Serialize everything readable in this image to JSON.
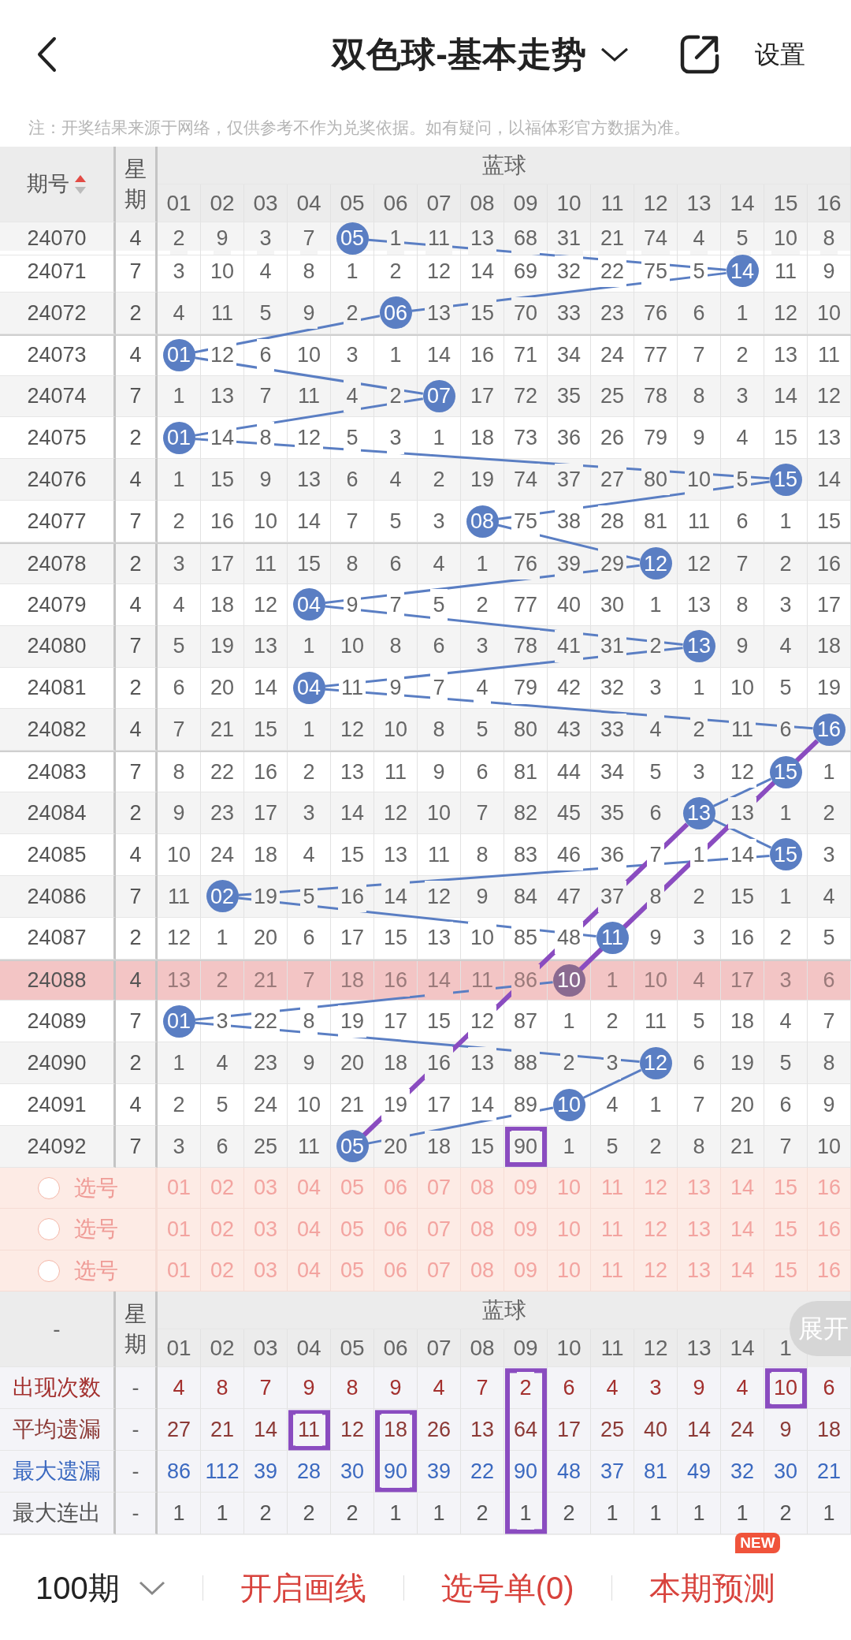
{
  "header": {
    "title": "双色球-基本走势",
    "settings": "设置"
  },
  "note": "注：开奖结果来源于网络，仅供参考不作为兑奖依据。如有疑问，以福体彩官方数据为准。",
  "table": {
    "period": "期号",
    "weekday": "星期",
    "group": "蓝球",
    "ascending": true,
    "numbers": [
      "01",
      "02",
      "03",
      "04",
      "05",
      "06",
      "07",
      "08",
      "09",
      "10",
      "11",
      "12",
      "13",
      "14",
      "15",
      "16"
    ]
  },
  "rows": [
    {
      "period": "24070",
      "weekday": "4",
      "highlighted": false,
      "cells": [
        "2",
        "9",
        "3",
        "7",
        {
          "ball": "05"
        },
        "1",
        "11",
        "13",
        "68",
        "31",
        "21",
        "74",
        "4",
        "5",
        "10",
        "8"
      ]
    },
    {
      "period": "24071",
      "weekday": "7",
      "highlighted": false,
      "cells": [
        "3",
        "10",
        "4",
        "8",
        "1",
        "2",
        "12",
        "14",
        "69",
        "32",
        "22",
        "75",
        "5",
        {
          "ball": "14"
        },
        "11",
        "9"
      ]
    },
    {
      "period": "24072",
      "weekday": "2",
      "highlighted": false,
      "cells": [
        "4",
        "11",
        "5",
        "9",
        "2",
        {
          "ball": "06"
        },
        "13",
        "15",
        "70",
        "33",
        "23",
        "76",
        "6",
        "1",
        "12",
        "10"
      ]
    },
    {
      "period": "24073",
      "weekday": "4",
      "highlighted": false,
      "cells": [
        {
          "ball": "01"
        },
        "12",
        "6",
        "10",
        "3",
        "1",
        "14",
        "16",
        "71",
        "34",
        "24",
        "77",
        "7",
        "2",
        "13",
        "11"
      ]
    },
    {
      "period": "24074",
      "weekday": "7",
      "highlighted": false,
      "cells": [
        "1",
        "13",
        "7",
        "11",
        "4",
        "2",
        {
          "ball": "07"
        },
        "17",
        "72",
        "35",
        "25",
        "78",
        "8",
        "3",
        "14",
        "12"
      ]
    },
    {
      "period": "24075",
      "weekday": "2",
      "highlighted": false,
      "cells": [
        {
          "ball": "01"
        },
        "14",
        "8",
        "12",
        "5",
        "3",
        "1",
        "18",
        "73",
        "36",
        "26",
        "79",
        "9",
        "4",
        "15",
        "13"
      ]
    },
    {
      "period": "24076",
      "weekday": "4",
      "highlighted": false,
      "cells": [
        "1",
        "15",
        "9",
        "13",
        "6",
        "4",
        "2",
        "19",
        "74",
        "37",
        "27",
        "80",
        "10",
        "5",
        {
          "ball": "15"
        },
        "14"
      ]
    },
    {
      "period": "24077",
      "weekday": "7",
      "highlighted": false,
      "cells": [
        "2",
        "16",
        "10",
        "14",
        "7",
        "5",
        "3",
        {
          "ball": "08"
        },
        "75",
        "38",
        "28",
        "81",
        "11",
        "6",
        "1",
        "15"
      ]
    },
    {
      "period": "24078",
      "weekday": "2",
      "highlighted": false,
      "cells": [
        "3",
        "17",
        "11",
        "15",
        "8",
        "6",
        "4",
        "1",
        "76",
        "39",
        "29",
        {
          "ball": "12"
        },
        "12",
        "7",
        "2",
        "16"
      ]
    },
    {
      "period": "24079",
      "weekday": "4",
      "highlighted": false,
      "cells": [
        "4",
        "18",
        "12",
        {
          "ball": "04"
        },
        "9",
        "7",
        "5",
        "2",
        "77",
        "40",
        "30",
        "1",
        "13",
        "8",
        "3",
        "17"
      ]
    },
    {
      "period": "24080",
      "weekday": "7",
      "highlighted": false,
      "cells": [
        "5",
        "19",
        "13",
        "1",
        "10",
        "8",
        "6",
        "3",
        "78",
        "41",
        "31",
        "2",
        {
          "ball": "13"
        },
        "9",
        "4",
        "18"
      ]
    },
    {
      "period": "24081",
      "weekday": "2",
      "highlighted": false,
      "cells": [
        "6",
        "20",
        "14",
        {
          "ball": "04"
        },
        "11",
        "9",
        "7",
        "4",
        "79",
        "42",
        "32",
        "3",
        "1",
        "10",
        "5",
        "19"
      ]
    },
    {
      "period": "24082",
      "weekday": "4",
      "highlighted": false,
      "cells": [
        "7",
        "21",
        "15",
        "1",
        "12",
        "10",
        "8",
        "5",
        "80",
        "43",
        "33",
        "4",
        "2",
        "11",
        "6",
        {
          "ball": "16",
          "line_end": true
        }
      ]
    },
    {
      "period": "24083",
      "weekday": "7",
      "highlighted": false,
      "cells": [
        "8",
        "22",
        "16",
        "2",
        "13",
        "11",
        "9",
        "6",
        "81",
        "44",
        "34",
        "5",
        "3",
        "12",
        {
          "ball": "15"
        },
        "1"
      ]
    },
    {
      "period": "24084",
      "weekday": "2",
      "highlighted": false,
      "cells": [
        "9",
        "23",
        "17",
        "3",
        "14",
        "12",
        "10",
        "7",
        "82",
        "45",
        "35",
        "6",
        {
          "ball": "13",
          "line_end": true
        },
        "13",
        "1",
        "2"
      ]
    },
    {
      "period": "24085",
      "weekday": "4",
      "highlighted": false,
      "cells": [
        "10",
        "24",
        "18",
        "4",
        "15",
        "13",
        "11",
        "8",
        "83",
        "46",
        "36",
        "7",
        "1",
        "14",
        {
          "ball": "15"
        },
        "3"
      ]
    },
    {
      "period": "24086",
      "weekday": "7",
      "highlighted": false,
      "cells": [
        "11",
        {
          "ball": "02"
        },
        "19",
        "5",
        "16",
        "14",
        "12",
        "9",
        "84",
        "47",
        "37",
        "8",
        "2",
        "15",
        "1",
        "4"
      ]
    },
    {
      "period": "24087",
      "weekday": "2",
      "highlighted": false,
      "cells": [
        "12",
        "1",
        "20",
        "6",
        "17",
        "15",
        "13",
        "10",
        "85",
        "48",
        {
          "ball": "11"
        },
        "9",
        "3",
        "16",
        "2",
        "5"
      ]
    },
    {
      "period": "24088",
      "weekday": "4",
      "highlighted": true,
      "cells": [
        "13",
        "2",
        "21",
        "7",
        "18",
        "16",
        "14",
        "11",
        "86",
        {
          "ball": "10",
          "line_start": true
        },
        "1",
        "10",
        "4",
        "17",
        "3",
        "6"
      ]
    },
    {
      "period": "24089",
      "weekday": "7",
      "highlighted": false,
      "cells": [
        {
          "ball": "01"
        },
        "3",
        "22",
        "8",
        "19",
        "17",
        "15",
        "12",
        "87",
        "1",
        "2",
        "11",
        "5",
        "18",
        "4",
        "7"
      ]
    },
    {
      "period": "24090",
      "weekday": "2",
      "highlighted": false,
      "cells": [
        "1",
        "4",
        "23",
        "9",
        "20",
        "18",
        "16",
        "13",
        "88",
        "2",
        "3",
        {
          "ball": "12"
        },
        "6",
        "19",
        "5",
        "8"
      ]
    },
    {
      "period": "24091",
      "weekday": "4",
      "highlighted": false,
      "cells": [
        "2",
        "5",
        "24",
        "10",
        "21",
        "19",
        "17",
        "14",
        "89",
        {
          "ball": "10"
        },
        "4",
        "1",
        "7",
        "20",
        "6",
        "9"
      ]
    },
    {
      "period": "24092",
      "weekday": "7",
      "highlighted": false,
      "cells": [
        "3",
        "6",
        "25",
        "11",
        {
          "ball": "05",
          "line_start": true
        },
        "20",
        "18",
        "15",
        {
          "value": "90",
          "boxed": true
        },
        "1",
        "5",
        "2",
        "8",
        "21",
        "7",
        "10"
      ]
    }
  ],
  "select_rows": [
    {
      "checked": false,
      "label": "选号",
      "numbers": [
        "01",
        "02",
        "03",
        "04",
        "05",
        "06",
        "07",
        "08",
        "09",
        "10",
        "11",
        "12",
        "13",
        "14",
        "15",
        "16"
      ]
    },
    {
      "checked": false,
      "label": "选号",
      "numbers": [
        "01",
        "02",
        "03",
        "04",
        "05",
        "06",
        "07",
        "08",
        "09",
        "10",
        "11",
        "12",
        "13",
        "14",
        "15",
        "16"
      ]
    },
    {
      "checked": false,
      "label": "选号",
      "numbers": [
        "01",
        "02",
        "03",
        "04",
        "05",
        "06",
        "07",
        "08",
        "09",
        "10",
        "11",
        "12",
        "13",
        "14",
        "15",
        "16"
      ]
    }
  ],
  "summary": {
    "period": "-",
    "weekday": "星期",
    "group": "蓝球",
    "expand": "展开",
    "numbers": [
      "01",
      "02",
      "03",
      "04",
      "05",
      "06",
      "07",
      "08",
      "09",
      "10",
      "11",
      "12",
      "13",
      "14",
      "1"
    ]
  },
  "stats": [
    {
      "label": "出现次数",
      "weekday": "-",
      "color": "#a3302e",
      "values": [
        "4",
        "8",
        "7",
        "9",
        "8",
        "9",
        "4",
        "7",
        {
          "value": "2",
          "boxed": true
        },
        "6",
        "4",
        "3",
        "9",
        "4",
        {
          "value": "10",
          "boxed": true
        },
        "6"
      ]
    },
    {
      "label": "平均遗漏",
      "weekday": "-",
      "color": "#8c3a36",
      "values": [
        "27",
        "21",
        "14",
        {
          "value": "11",
          "boxed": true
        },
        "12",
        {
          "value": "18",
          "boxed": true
        },
        "26",
        "13",
        {
          "value": "64",
          "boxed": true
        },
        "17",
        "25",
        "40",
        "14",
        "24",
        "9",
        "18"
      ]
    },
    {
      "label": "最大遗漏",
      "weekday": "-",
      "color": "#3b69c0",
      "values": [
        "86",
        "112",
        "39",
        "28",
        "30",
        {
          "value": "90",
          "boxed": true
        },
        "39",
        "22",
        {
          "value": "90",
          "boxed": true
        },
        "48",
        "37",
        "81",
        "49",
        "32",
        "30",
        "21"
      ]
    },
    {
      "label": "最大连出",
      "weekday": "-",
      "color": "#555555",
      "values": [
        "1",
        "1",
        "2",
        "2",
        "2",
        "1",
        "1",
        "2",
        {
          "value": "1",
          "boxed": true
        },
        "2",
        "1",
        "1",
        "1",
        "1",
        "2",
        "1"
      ]
    }
  ],
  "bottom_bar": {
    "periods": "100期",
    "actions": [
      {
        "label": "开启画线"
      },
      {
        "label": "选号单(0)"
      },
      {
        "label": "本期预测",
        "badge": "NEW"
      }
    ]
  }
}
